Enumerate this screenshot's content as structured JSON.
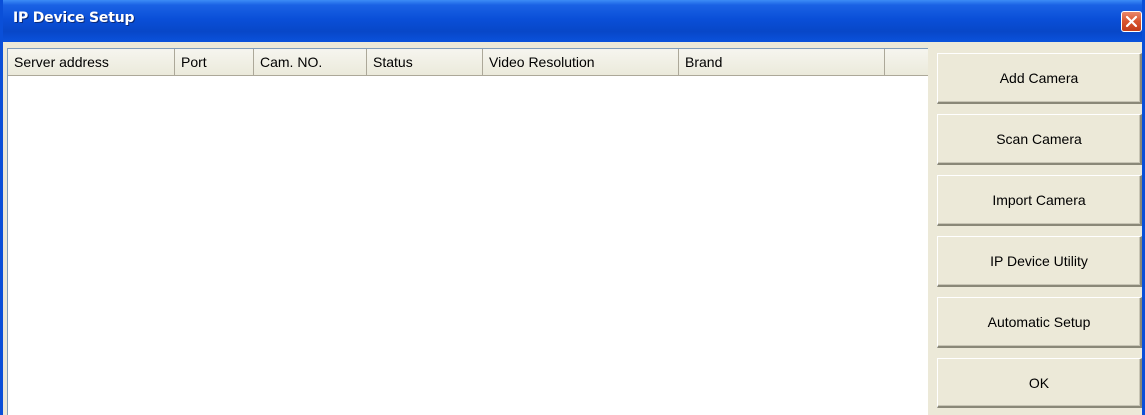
{
  "window": {
    "title": "IP Device Setup"
  },
  "table": {
    "columns": [
      "Server address",
      "Port",
      "Cam. NO.",
      "Status",
      "Video Resolution",
      "Brand"
    ],
    "rows": []
  },
  "buttons": {
    "add_camera": "Add Camera",
    "scan_camera": "Scan Camera",
    "import_camera": "Import Camera",
    "ip_device_utility": "IP Device Utility",
    "automatic_setup": "Automatic Setup",
    "ok": "OK"
  },
  "colors": {
    "titlebar": "#0a4fd8",
    "close_button": "#d8542e",
    "face": "#ece9d8"
  }
}
